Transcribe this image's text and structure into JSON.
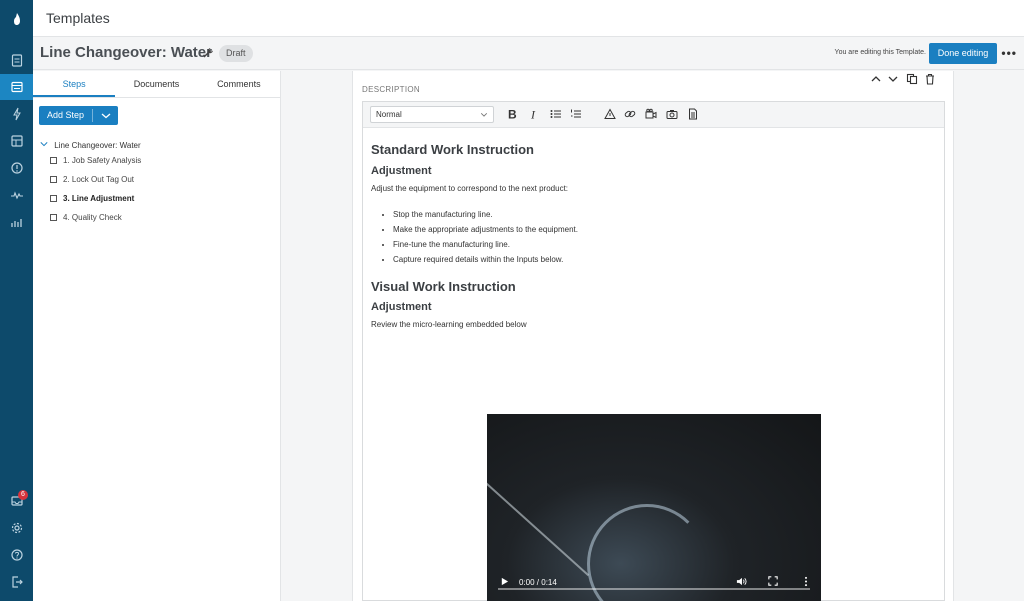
{
  "app": {
    "page_title": "Templates"
  },
  "rail": {
    "notification_count": "6"
  },
  "template": {
    "name": "Line Changeover: Water",
    "status_badge": "Draft",
    "editing_notice": "You are editing this Template.",
    "done_label": "Done editing",
    "more_label": "•••"
  },
  "left": {
    "tabs": [
      "Steps",
      "Documents",
      "Comments"
    ],
    "active_tab": "Steps",
    "add_step_label": "Add Step",
    "tree_root": "Line Changeover: Water",
    "steps": [
      {
        "label": "1.  Job Safety Analysis",
        "bold": false
      },
      {
        "label": "2.  Lock Out Tag Out",
        "bold": false
      },
      {
        "label": "3.  Line Adjustment",
        "bold": true
      },
      {
        "label": "4.  Quality Check",
        "bold": false
      }
    ]
  },
  "editor": {
    "section_label": "DESCRIPTION",
    "format_value": "Normal",
    "heading1": "Standard Work Instruction",
    "sub1": "Adjustment",
    "para1": "Adjust the equipment to correspond to the next product:",
    "bullets": [
      "Stop the manufacturing line.",
      "Make the appropriate adjustments to the equipment.",
      "Fine-tune the manufacturing line.",
      "Capture required details within the Inputs below."
    ],
    "heading2": "Visual Work Instruction",
    "sub2": "Adjustment",
    "para2": "Review the micro-learning embedded below",
    "video_time": "0:00 / 0:14"
  },
  "colors": {
    "rail": "#0d4a6b",
    "accent": "#1a7fc1"
  }
}
